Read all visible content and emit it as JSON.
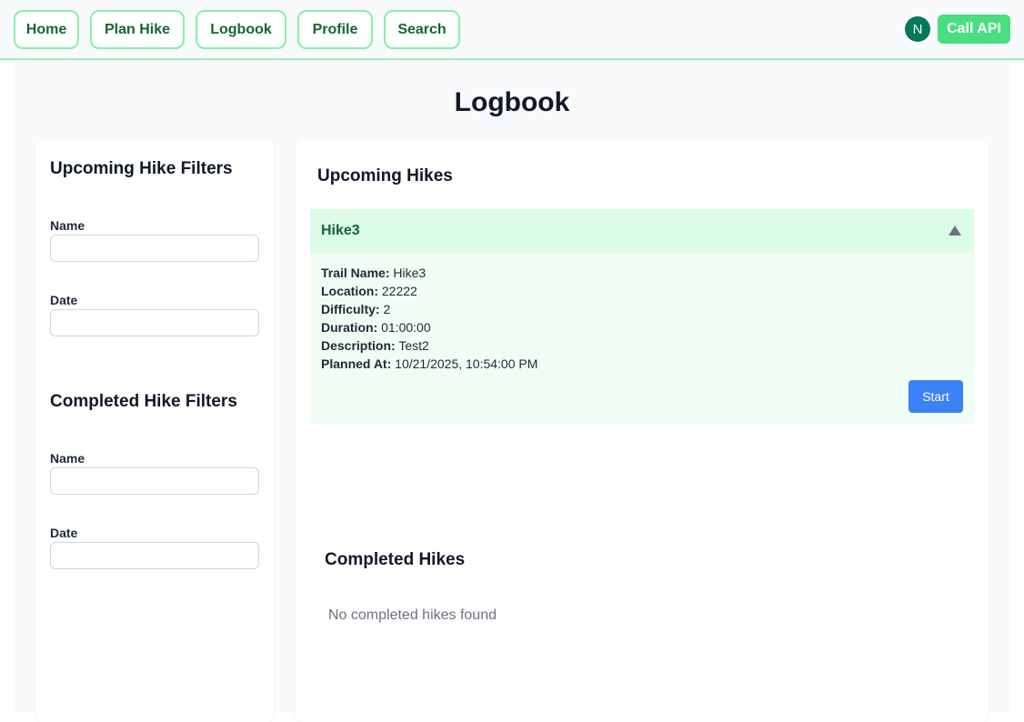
{
  "nav": {
    "items": [
      {
        "label": "Home"
      },
      {
        "label": "Plan Hike"
      },
      {
        "label": "Logbook"
      },
      {
        "label": "Profile"
      },
      {
        "label": "Search"
      }
    ],
    "avatar_initial": "N",
    "call_api_label": "Call API"
  },
  "page": {
    "title": "Logbook"
  },
  "filters": {
    "upcoming": {
      "title": "Upcoming Hike Filters",
      "name_label": "Name",
      "date_label": "Date",
      "name_value": "",
      "date_value": ""
    },
    "completed": {
      "title": "Completed Hike Filters",
      "name_label": "Name",
      "date_label": "Date",
      "name_value": "",
      "date_value": ""
    }
  },
  "upcoming": {
    "title": "Upcoming Hikes",
    "hike": {
      "name": "Hike3",
      "trail_name_label": "Trail Name:",
      "trail_name": "Hike3",
      "location_label": "Location:",
      "location": "22222",
      "difficulty_label": "Difficulty:",
      "difficulty": "2",
      "duration_label": "Duration:",
      "duration": "01:00:00",
      "description_label": "Description:",
      "description": "Test2",
      "planned_at_label": "Planned At:",
      "planned_at": "10/21/2025, 10:54:00 PM",
      "start_label": "Start"
    }
  },
  "completed": {
    "title": "Completed Hikes",
    "empty_message": "No completed hikes found"
  },
  "colors": {
    "accent_green": "#4ade80",
    "nav_border": "#86efac",
    "hike_header_bg": "#dcfce7",
    "start_button": "#3b82f6",
    "avatar": "#047857"
  }
}
